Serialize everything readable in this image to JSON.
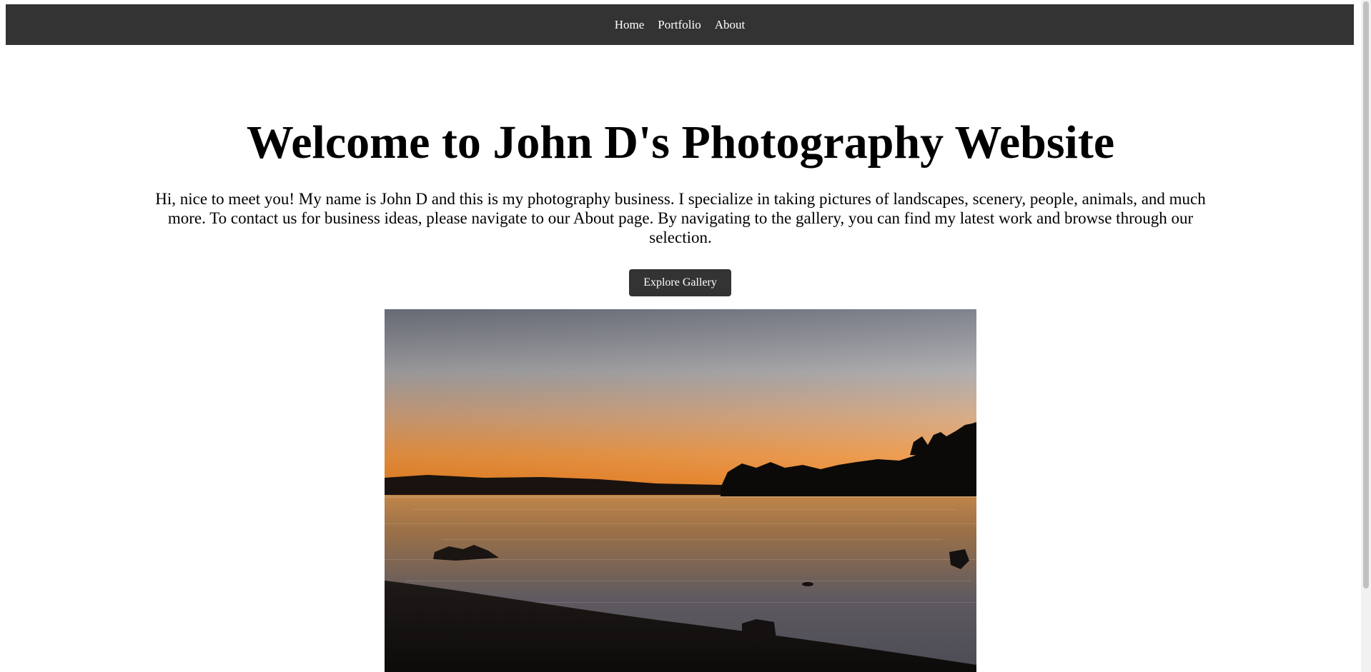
{
  "nav": {
    "items": [
      {
        "label": "Home"
      },
      {
        "label": "Portfolio"
      },
      {
        "label": "About"
      }
    ]
  },
  "hero": {
    "title": "Welcome to John D's Photography Website",
    "intro": "Hi, nice to meet you! My name is John D and this is my photography business. I specialize in taking pictures of landscapes, scenery, people, animals, and much more. To contact us for business ideas, please navigate to our About page. By navigating to the gallery, you can find my latest work and browse through our selection.",
    "button_label": "Explore Gallery"
  },
  "colors": {
    "nav_background": "#333333",
    "button_background": "#333333",
    "text": "#000000"
  }
}
